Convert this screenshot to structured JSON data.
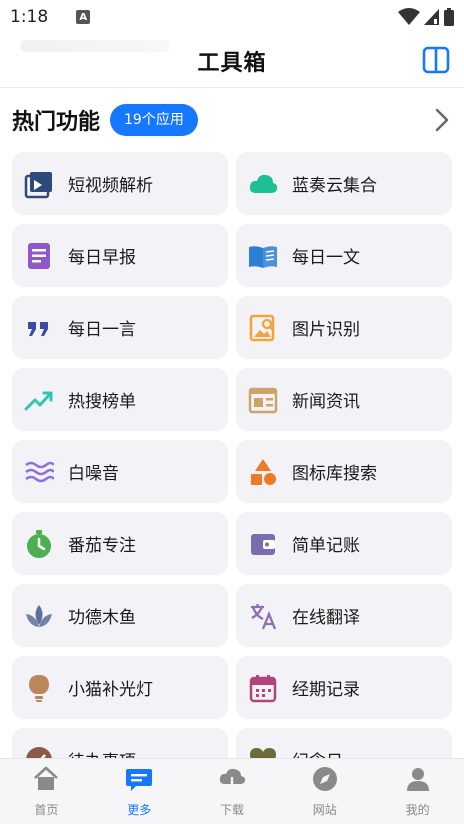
{
  "status": {
    "time": "1:18",
    "notif_letter": "A"
  },
  "header": {
    "title": "工具箱"
  },
  "section": {
    "title": "热门功能",
    "count": "19个应用"
  },
  "tools": [
    {
      "label": "短视频解析",
      "icon": "video-play-icon",
      "color": "#2d4a7a"
    },
    {
      "label": "蓝奏云集合",
      "icon": "cloud-icon",
      "color": "#1fbf95"
    },
    {
      "label": "每日早报",
      "icon": "document-icon",
      "color": "#8e58c8"
    },
    {
      "label": "每日一文",
      "icon": "open-book-icon",
      "color": "#2b7fd4"
    },
    {
      "label": "每日一言",
      "icon": "quote-icon",
      "color": "#3d4aa3"
    },
    {
      "label": "图片识别",
      "icon": "image-search-icon",
      "color": "#f2a33a"
    },
    {
      "label": "热搜榜单",
      "icon": "trending-icon",
      "color": "#2cc7b0"
    },
    {
      "label": "新闻资讯",
      "icon": "newspaper-icon",
      "color": "#caa565"
    },
    {
      "label": "白噪音",
      "icon": "waves-icon",
      "color": "#8e6fe0"
    },
    {
      "label": "图标库搜索",
      "icon": "shapes-icon",
      "color": "#f07a22"
    },
    {
      "label": "番茄专注",
      "icon": "timer-icon",
      "color": "#4caf50"
    },
    {
      "label": "简单记账",
      "icon": "wallet-icon",
      "color": "#7b6bb0"
    },
    {
      "label": "功德木鱼",
      "icon": "lotus-icon",
      "color": "#5b6f9a"
    },
    {
      "label": "在线翻译",
      "icon": "translate-icon",
      "color": "#8e6fb0"
    },
    {
      "label": "小猫补光灯",
      "icon": "bulb-icon",
      "color": "#b9875a"
    },
    {
      "label": "经期记录",
      "icon": "calendar-icon",
      "color": "#b0457a"
    },
    {
      "label": "待办事项",
      "icon": "todo-icon",
      "color": "#8a5a44"
    },
    {
      "label": "纪念日",
      "icon": "heart-icon",
      "color": "#6b6b3a"
    }
  ],
  "nav": [
    {
      "label": "首页",
      "icon": "home-icon"
    },
    {
      "label": "更多",
      "icon": "more-chat-icon",
      "active": true
    },
    {
      "label": "下载",
      "icon": "download-cloud-icon"
    },
    {
      "label": "网站",
      "icon": "compass-icon"
    },
    {
      "label": "我的",
      "icon": "user-icon"
    }
  ],
  "colors": {
    "accent": "#1677ff",
    "card_bg": "#f3f3f7"
  }
}
